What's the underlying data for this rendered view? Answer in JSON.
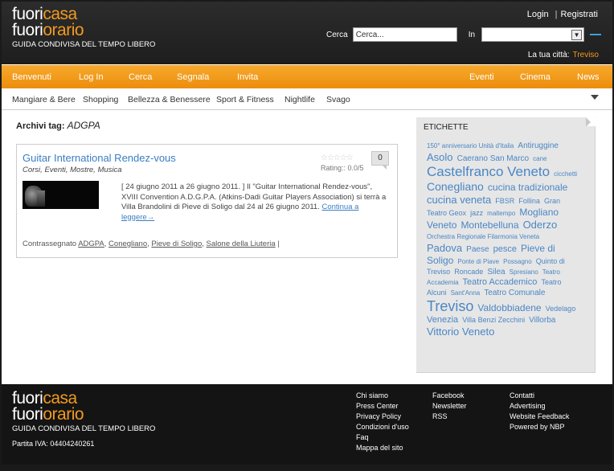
{
  "header": {
    "logo_word1_a": "fuori",
    "logo_word1_b": "casa",
    "logo_word2_a": "fuori",
    "logo_word2_b": "orario",
    "tagline": "GUIDA CONDIVISA DEL TEMPO LIBERO",
    "login_label": "Login",
    "register_label": "Registrati",
    "search_label": "Cerca",
    "search_value": "Cerca...",
    "in_label": "In",
    "city_label": "La tua città:",
    "city_value": "Treviso"
  },
  "nav": {
    "items": [
      "Benvenuti",
      "Log In",
      "Cerca",
      "Segnala",
      "Invita",
      "Eventi",
      "Cinema",
      "News"
    ]
  },
  "subnav": {
    "items": [
      "Mangiare & Bere",
      "Shopping",
      "Bellezza & Benessere",
      "Sport & Fitness",
      "Nightlife",
      "Svago"
    ]
  },
  "archive": {
    "prefix": "Archivi tag:",
    "tag": "ADGPA"
  },
  "post": {
    "title": "Guitar International Rendez-vous",
    "categories": "Corsi, Eventi, Mostre, Musica",
    "stars": "☆☆☆☆☆",
    "rating": "Rating:: 0.0/5",
    "comments": "0",
    "excerpt": "[ 24 giugno 2011 a 26 giugno 2011. ] Il \"Guitar International Rendez-vous\", XVIII Convention A.D.G.P.A. (Atkins-Dadi Guitar Players Association) si terrà a Villa Brandolini di Pieve di Soligo dal 24 al 26 giugno 2011.",
    "read_more": "Continua a leggere→",
    "tags_prefix": "Contrassegnato",
    "tags": [
      "ADGPA",
      "Conegliano",
      "Pieve di Soligo",
      "Salone della Liuteria"
    ],
    "tags_suffix": "|"
  },
  "sidebar": {
    "title": "ETICHETTE",
    "cloud": [
      {
        "t": "150° anniversario Unità d'Italia",
        "s": 8
      },
      {
        "t": "Antiruggine",
        "s": 10
      },
      {
        "t": "Asolo",
        "s": 13
      },
      {
        "t": "Caerano San Marco",
        "s": 10
      },
      {
        "t": "cane",
        "s": 8
      },
      {
        "t": "Castelfranco Veneto",
        "s": 17
      },
      {
        "t": "cicchetti",
        "s": 8
      },
      {
        "t": "Conegliano",
        "s": 14
      },
      {
        "t": "cucina tradizionale",
        "s": 12
      },
      {
        "t": "cucina veneta",
        "s": 13
      },
      {
        "t": "FBSR",
        "s": 9
      },
      {
        "t": "Follina",
        "s": 9
      },
      {
        "t": "Gran Teatro Geox",
        "s": 9
      },
      {
        "t": "jazz",
        "s": 9
      },
      {
        "t": "maltempo",
        "s": 8
      },
      {
        "t": "Mogliano Veneto",
        "s": 12
      },
      {
        "t": "Montebelluna",
        "s": 12
      },
      {
        "t": "Oderzo",
        "s": 13
      },
      {
        "t": "Orchestra Regionale Filarmonia Veneta",
        "s": 8
      },
      {
        "t": "Padova",
        "s": 13
      },
      {
        "t": "Paese",
        "s": 10
      },
      {
        "t": "pesce",
        "s": 11
      },
      {
        "t": "Pieve di Soligo",
        "s": 12
      },
      {
        "t": "Ponte di Piave",
        "s": 8
      },
      {
        "t": "Possagno",
        "s": 8
      },
      {
        "t": "Quinto di Treviso",
        "s": 9
      },
      {
        "t": "Roncade",
        "s": 9
      },
      {
        "t": "Silea",
        "s": 10
      },
      {
        "t": "Spresiano",
        "s": 8
      },
      {
        "t": "Teatro Accademia",
        "s": 8
      },
      {
        "t": "Teatro Accademico",
        "s": 11
      },
      {
        "t": "Teatro Alcuni",
        "s": 9
      },
      {
        "t": "Sant'Anna",
        "s": 8
      },
      {
        "t": "Teatro Comunale",
        "s": 10
      },
      {
        "t": "Treviso",
        "s": 18
      },
      {
        "t": "Valdobbiadene",
        "s": 12
      },
      {
        "t": "Vedelago",
        "s": 9
      },
      {
        "t": "Venezia",
        "s": 11
      },
      {
        "t": "Villa Benzi Zecchini",
        "s": 9
      },
      {
        "t": "Villorba",
        "s": 10
      },
      {
        "t": "Vittorio Veneto",
        "s": 13
      }
    ]
  },
  "footer": {
    "tagline": "GUIDA CONDIVISA DEL TEMPO LIBERO",
    "piva": "Partita IVA: 04404240261",
    "col1": [
      "Chi siamo",
      "Press Center",
      "Privacy Policy",
      "Condizioni d'uso",
      "Faq",
      "Mappa del sito"
    ],
    "col2": [
      "Facebook",
      "Newsletter",
      "RSS"
    ],
    "col3": [
      "Contatti",
      "Advertising",
      "Website Feedback",
      "Powered by NBP"
    ]
  },
  "colors": {
    "accent_orange": "#f39a1e",
    "link_blue": "#3a7ec2",
    "header_dark": "#232323"
  }
}
